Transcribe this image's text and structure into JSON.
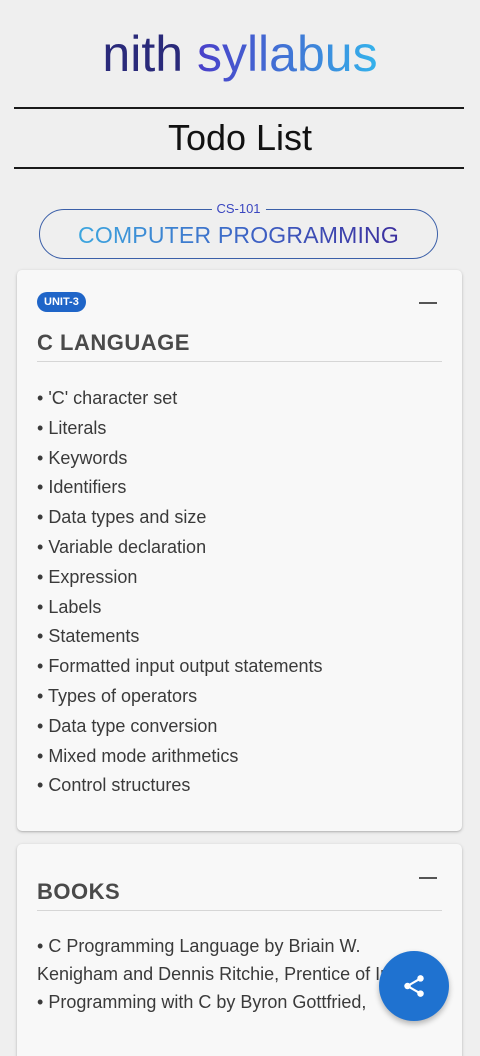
{
  "brand": {
    "word1": "nith",
    "word2": "syllabus"
  },
  "page_title": "Todo List",
  "course": {
    "code": "CS-101",
    "name": "COMPUTER PROGRAMMING"
  },
  "unit_card": {
    "badge": "UNIT-3",
    "title": "C LANGUAGE",
    "topics": [
      "'C' character set",
      "Literals",
      "Keywords",
      "Identifiers",
      "Data types and size",
      "Variable declaration",
      "Expression",
      "Labels",
      "Statements",
      "Formatted input output statements",
      "Types of operators",
      "Data type conversion",
      "Mixed mode arithmetics",
      "Control structures"
    ]
  },
  "books_card": {
    "title": "BOOKS",
    "books": [
      "C Programming Language by Briain W. Kenigham and Dennis Ritchie, Prentice of India.",
      "Programming with C by Byron Gottfried,"
    ]
  },
  "fab": {
    "icon": "share-icon",
    "color": "#1f72d0"
  },
  "colors": {
    "badge": "#1f65c8",
    "background": "#efefef",
    "card": "#f8f8f8"
  }
}
